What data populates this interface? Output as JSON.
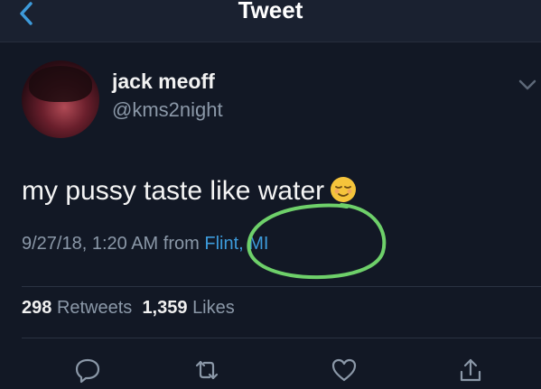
{
  "nav": {
    "title": "Tweet"
  },
  "author": {
    "display_name": "jack meoff",
    "handle": "@kms2night"
  },
  "tweet": {
    "text": "my pussy taste like water",
    "emoji": "relieved-face-icon",
    "timestamp": "9/27/18, 1:20 AM",
    "from_word": "from",
    "location": "Flint, MI"
  },
  "stats": {
    "retweets_count": "298",
    "retweets_label": "Retweets",
    "likes_count": "1,359",
    "likes_label": "Likes"
  },
  "actions": [
    "reply-icon",
    "retweet-icon",
    "like-icon",
    "share-icon"
  ],
  "colors": {
    "background": "#121825",
    "accent": "#3d9bdb",
    "secondary_text": "#8b98a8",
    "annotation": "#6ed06a"
  }
}
